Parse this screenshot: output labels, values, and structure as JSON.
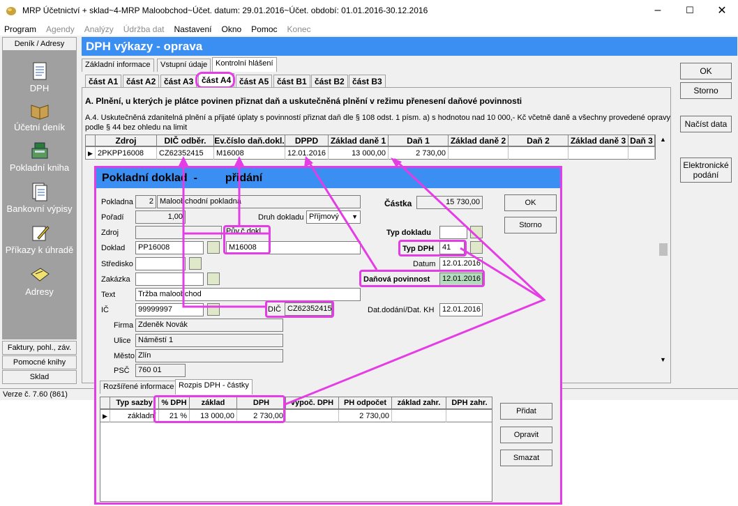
{
  "window": {
    "title": "MRP Účetnictví + sklad~4-MRP Maloobchod~Účet. datum: 29.01.2016~Účet. období: 01.01.2016-30.12.2016",
    "minimize": "–",
    "maximize": "☐",
    "close": "✕"
  },
  "menu": [
    "Program",
    "Agendy",
    "Analýzy",
    "Údržba dat",
    "Nastavení",
    "Okno",
    "Pomoc",
    "Konec"
  ],
  "sidebar": {
    "top": "Deník / Adresy",
    "items": [
      "DPH",
      "Účetní deník",
      "Pokladní kniha",
      "Bankovní výpisy",
      "Příkazy k úhradě",
      "Adresy"
    ],
    "bottom": [
      "Faktury, pohl., záv.",
      "Pomocné knihy",
      "Sklad"
    ]
  },
  "main": {
    "title": "DPH výkazy - oprava",
    "tabs": [
      "Základní informace",
      "Vstupní údaje",
      "Kontrolní hlášení"
    ],
    "subtabs": [
      "část A1",
      "část A2",
      "část A3",
      "část A4",
      "část A5",
      "část B1",
      "část B2",
      "část B3"
    ],
    "heading": "A. Plnění, u kterých je plátce povinen přiznat daň a uskutečněná plnění v režimu přenesení daňové povinnosti",
    "desc1": "A.4. Uskutečněná zdanitelná plnění a přijaté úplaty s povinností přiznat daň dle § 108 odst. 1 písm. a) s hodnotou nad 10 000,- Kč včetně daně a všechny provedené opravy",
    "desc2": "podle § 44 bez ohledu na limit",
    "grid_columns": [
      "Zdroj",
      "DIČ odběr.",
      "Ev.číslo daň.dokl.",
      "DPPD",
      "Základ daně 1",
      "Daň 1",
      "Základ daně 2",
      "Daň 2",
      "Základ daně 3",
      "Daň 3"
    ],
    "grid_row": [
      "2PKPP16008",
      "CZ62352415",
      "M16008",
      "12.01.2016",
      "13 000,00",
      "2 730,00",
      "",
      "",
      "",
      ""
    ]
  },
  "right_buttons": [
    "OK",
    "Storno",
    "Načíst data",
    "Elektronické podání"
  ],
  "status": "Verze č. 7.60 (861)",
  "dialog": {
    "title": "Pokladní doklad  -         přidání",
    "pokladna_label": "Pokladna",
    "pokladna_num": "2",
    "pokladna_name": "Maloobchodní pokladna",
    "poradi_label": "Pořadí",
    "poradi": "1,00",
    "druh_label": "Druh dokladu",
    "druh": "Příjmový",
    "zdroj_label": "Zdroj",
    "puv_label": "Pův.č.dokl.",
    "puv": "M16008",
    "doklad_label": "Doklad",
    "doklad": "PP16008",
    "stredisko_label": "Středisko",
    "zakazka_label": "Zakázka",
    "text_label": "Text",
    "text": "Tržba maloobchod",
    "ic_label": "IČ",
    "ic": "99999997",
    "dic_label": "DIČ",
    "dic": "CZ62352415",
    "firma_label": "Firma",
    "firma": "Zdeněk Novák",
    "ulice_label": "Ulice",
    "ulice": "Náměstí 1",
    "mesto_label": "Město",
    "mesto": "Zlín",
    "psc_label": "PSČ",
    "psc": "760 01",
    "castka_label": "Částka",
    "castka": "15 730,00",
    "typ_dokladu_label": "Typ dokladu",
    "typ_dph_label": "Typ DPH",
    "typ_dph": "41",
    "datum_label": "Datum",
    "datum": "12.01.2016",
    "danova_label": "Daňová povinnost",
    "danova": "12.01.2016",
    "datdodani_label": "Dat.dodání/Dat. KH",
    "datdodani": "12.01.2016",
    "ok": "OK",
    "storno": "Storno",
    "tabs": [
      "Rozšířené informace",
      "Rozpis DPH - částky"
    ],
    "grid_columns": [
      "Typ sazby",
      "% DPH",
      "základ",
      "DPH",
      "vypoč. DPH",
      "PH odpočet",
      "základ zahr.",
      "DPH zahr."
    ],
    "grid_row": [
      "základní",
      "21 %",
      "13 000,00",
      "2 730,00",
      "",
      "2 730,00",
      "",
      ""
    ],
    "pridat": "Přidat",
    "opravit": "Opravit",
    "smazat": "Smazat"
  }
}
